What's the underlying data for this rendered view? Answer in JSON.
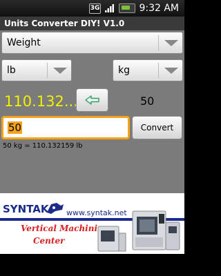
{
  "status_bar": {
    "network_label": "3G",
    "time": "9:32 AM",
    "icons": [
      "3g-icon",
      "signal-icon",
      "battery-icon"
    ]
  },
  "app": {
    "title": "Units Converter DIY! V1.0"
  },
  "category_spinner": {
    "selected": "Weight"
  },
  "from_unit_spinner": {
    "selected": "lb"
  },
  "to_unit_spinner": {
    "selected": "kg"
  },
  "result_value": "110.132...",
  "swap_button": {
    "icon": "arrow-left-icon"
  },
  "input_echo": "50",
  "input": {
    "value": "50"
  },
  "convert_button": {
    "label": "Convert"
  },
  "equation": "50 kg = 110.132159 lb",
  "ad": {
    "logo": "SYNTAK",
    "url": "www.syntak.net",
    "line1": "Vertical Machining",
    "line2": "Center"
  },
  "colors": {
    "result_text": "#f0f000",
    "input_border": "#f5a31a",
    "ad_red": "#d81f1f",
    "ad_blue": "#1c2a8c"
  }
}
